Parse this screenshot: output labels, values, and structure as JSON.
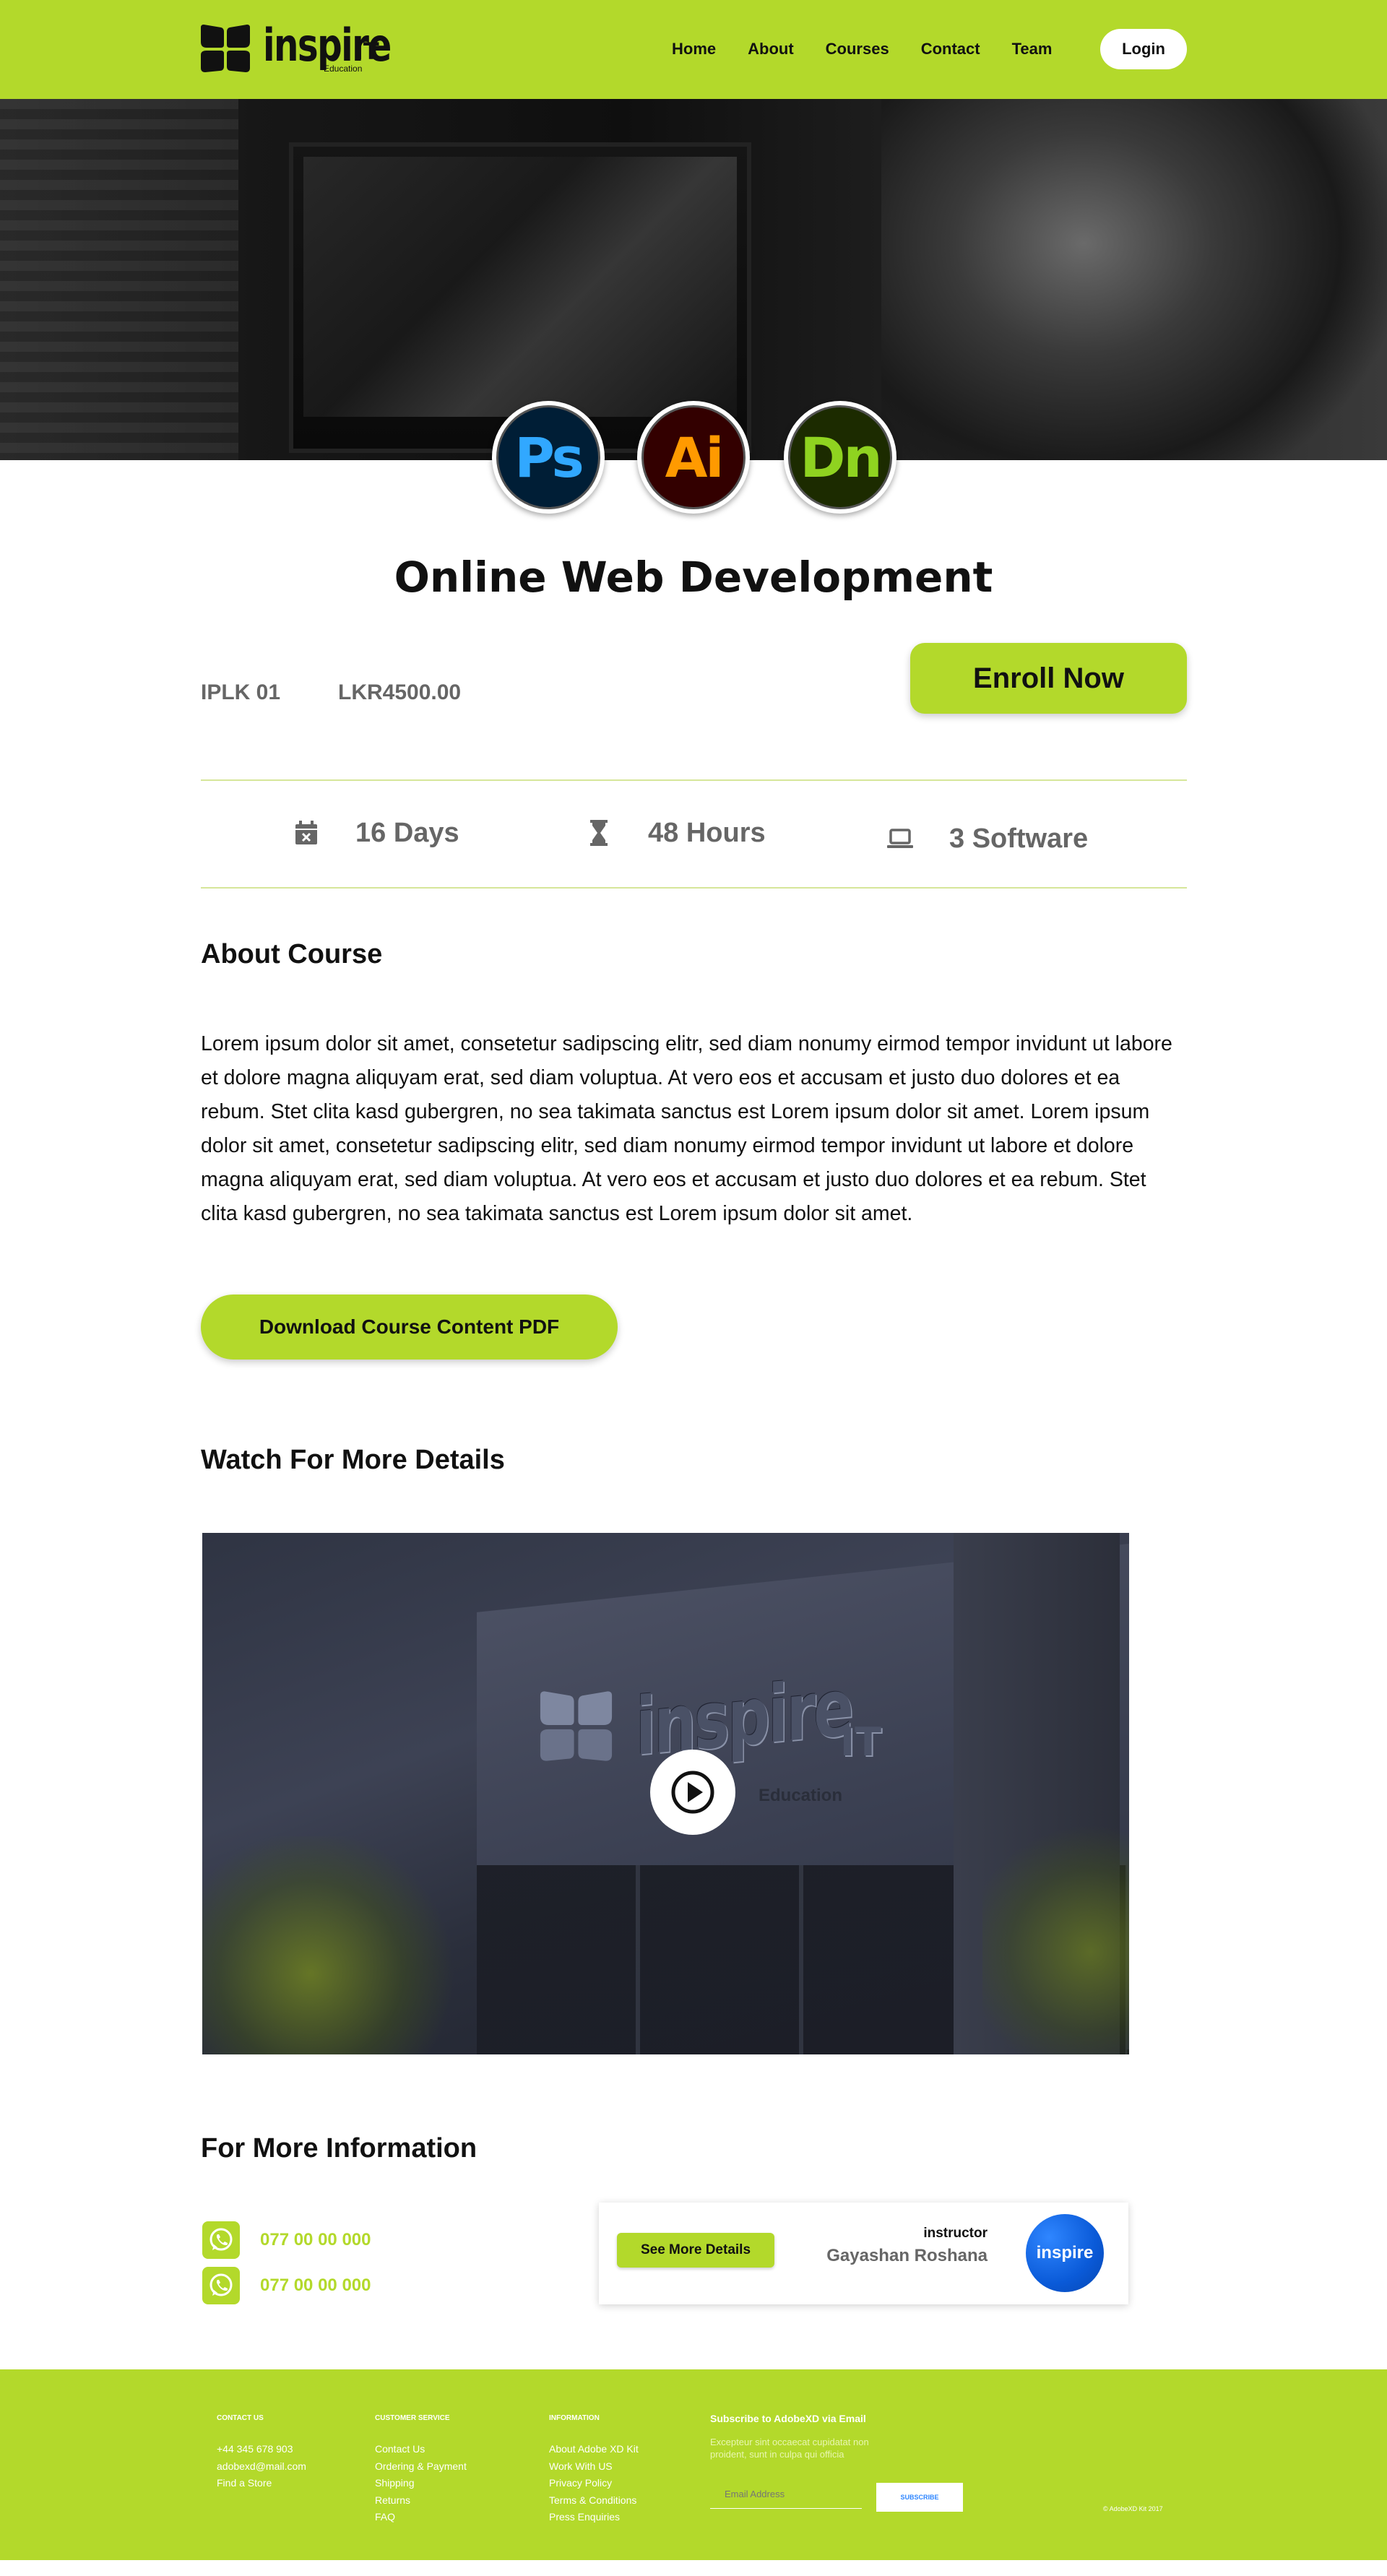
{
  "nav": {
    "logo_word": "inspire",
    "logo_it": "IT",
    "logo_sub": "Education",
    "items": [
      "Home",
      "About",
      "Courses",
      "Contact",
      "Team"
    ],
    "login": "Login"
  },
  "software": [
    {
      "name": "photoshop-icon",
      "label": "Ps"
    },
    {
      "name": "illustrator-icon",
      "label": "Ai"
    },
    {
      "name": "dimension-icon",
      "label": "Dn"
    }
  ],
  "course": {
    "title": "Online Web Development",
    "code": "IPLK 01",
    "price": "LKR4500.00",
    "enroll": "Enroll Now",
    "stats": {
      "days": "16 Days",
      "hours": "48 Hours",
      "software": "3 Software"
    }
  },
  "about": {
    "heading": "About Course",
    "text": "Lorem ipsum dolor sit amet, consetetur sadipscing elitr, sed diam nonumy eirmod tempor invidunt ut labore et dolore magna aliquyam erat, sed diam voluptua. At vero eos et accusam et justo duo dolores et ea rebum. Stet clita kasd gubergren, no sea takimata sanctus est Lorem ipsum dolor sit amet. Lorem ipsum dolor sit amet, consetetur sadipscing elitr, sed diam nonumy eirmod tempor invidunt ut labore et dolore magna aliquyam erat, sed diam voluptua. At vero eos et accusam et justo duo dolores et ea rebum. Stet clita kasd gubergren, no sea takimata sanctus est Lorem ipsum dolor sit amet.",
    "download": "Download Course Content PDF"
  },
  "video": {
    "heading": "Watch For More Details",
    "sign_word": "inspire",
    "sign_it": "IT",
    "sign_sub": "Education"
  },
  "info": {
    "heading": "For More Information",
    "phones": [
      "077 00 00 000",
      "077 00 00 000"
    ],
    "see_more": "See More Details",
    "role": "instructor",
    "instructor": "Gayashan Roshana",
    "avatar_text": "inspire"
  },
  "footer": {
    "contact_heading": "CONTACT US",
    "contact_items": [
      "+44 345 678 903",
      "adobexd@mail.com",
      "Find a Store"
    ],
    "service_heading": "CUSTOMER SERVICE",
    "service_items": [
      "Contact Us",
      "Ordering & Payment",
      "Shipping",
      "Returns",
      "FAQ"
    ],
    "info_heading": "INFORMATION",
    "info_items": [
      "About Adobe XD Kit",
      "Work With US",
      "Privacy Policy",
      "Terms & Conditions",
      "Press Enquiries"
    ],
    "subscribe_title": "Subscribe to AdobeXD via Email",
    "subscribe_desc": "Excepteur sint occaecat cupidatat non proident, sunt in culpa qui officia",
    "email_placeholder": "Email Address",
    "subscribe_btn": "SUBSCRIBE",
    "copyright": "© AdobeXD Kit 2017"
  },
  "colors": {
    "accent": "#b3d92b",
    "text_gray": "#666666",
    "avatar_blue": "#0a5ad8"
  }
}
